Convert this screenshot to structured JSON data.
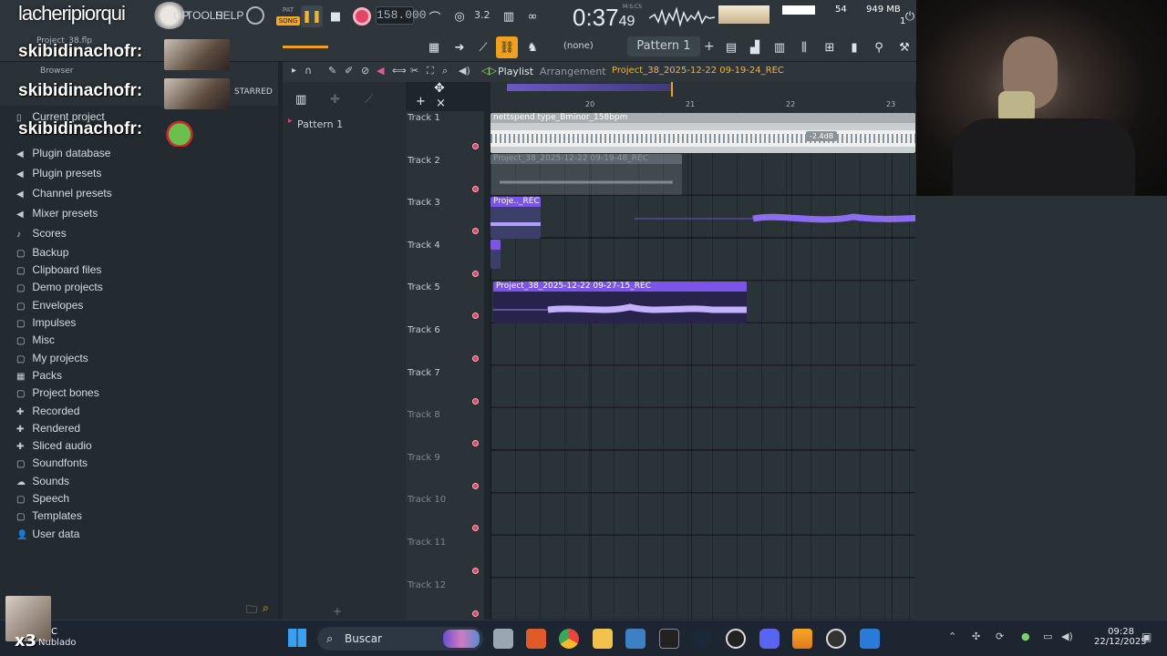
{
  "overlay": {
    "streamer_name": "lacheripiorqui",
    "chat_user": "skibidinachofr:",
    "badge": "x3"
  },
  "menu": {
    "tools": "TOOLS",
    "help": "HELP",
    "op": "OP"
  },
  "transport": {
    "pat_label": "PAT",
    "song_label": "SONG",
    "tempo": "158.000",
    "time_main": "0:37",
    "time_sub": "49",
    "time_unit": "M:S:CS",
    "cpu": "54",
    "memory": "949 MB",
    "memory_sub": "1",
    "snap": "(none)",
    "pattern": "Pattern 1",
    "step": "3.2"
  },
  "browser": {
    "project_file": "Project_38.flp",
    "title": "Browser",
    "starred": "STARRED",
    "items": [
      {
        "label": "Current project",
        "icon": "file-icon"
      },
      {
        "label": "Plugin database",
        "icon": "plug-icon"
      },
      {
        "label": "Plugin presets",
        "icon": "plug-icon"
      },
      {
        "label": "Channel presets",
        "icon": "plug-icon"
      },
      {
        "label": "Mixer presets",
        "icon": "plug-icon"
      },
      {
        "label": "Scores",
        "icon": "note-icon"
      },
      {
        "label": "Backup",
        "icon": "folder-icon"
      },
      {
        "label": "Clipboard files",
        "icon": "folder-icon"
      },
      {
        "label": "Demo projects",
        "icon": "folder-icon"
      },
      {
        "label": "Envelopes",
        "icon": "folder-icon"
      },
      {
        "label": "Impulses",
        "icon": "folder-icon"
      },
      {
        "label": "Misc",
        "icon": "folder-icon"
      },
      {
        "label": "My projects",
        "icon": "folder-icon"
      },
      {
        "label": "Packs",
        "icon": "packs-icon"
      },
      {
        "label": "Project bones",
        "icon": "folder-icon"
      },
      {
        "label": "Recorded",
        "icon": "plus-icon"
      },
      {
        "label": "Rendered",
        "icon": "plus-icon"
      },
      {
        "label": "Sliced audio",
        "icon": "plus-icon"
      },
      {
        "label": "Soundfonts",
        "icon": "folder-icon"
      },
      {
        "label": "Sounds",
        "icon": "cloud-icon"
      },
      {
        "label": "Speech",
        "icon": "folder-icon"
      },
      {
        "label": "Templates",
        "icon": "folder-icon"
      },
      {
        "label": "User data",
        "icon": "user-icon"
      }
    ]
  },
  "patterns": {
    "items": [
      "Pattern 1"
    ]
  },
  "playlist": {
    "title": "Playlist",
    "subtitle": "Arrangement",
    "project": "Project_38_2025-12-22 09-19-24_REC",
    "ruler": [
      "20",
      "21",
      "22",
      "23"
    ],
    "tracks": [
      "Track 1",
      "Track 2",
      "Track 3",
      "Track 4",
      "Track 5",
      "Track 6",
      "Track 7",
      "Track 8",
      "Track 9",
      "Track 10",
      "Track 11",
      "Track 12"
    ],
    "clips": [
      {
        "name": "nettspend type_Bminor_158bpm",
        "gain": "-2.4dB"
      },
      {
        "name": "Project_38_2025-12-22 09-19-48_REC"
      },
      {
        "name": "Proje.._REC"
      },
      {
        "name": ""
      },
      {
        "name": "Project_38_2025-12-22 09-27-15_REC"
      }
    ]
  },
  "taskbar": {
    "search": "Buscar",
    "time": "09:28",
    "date": "22/12/2025",
    "weather_temp": "C",
    "weather_desc": "Nublado"
  },
  "colors": {
    "accent": "#f2b33d",
    "clip_purple": "#7a55e8",
    "clip_gray": "#c9cdd0",
    "record": "#e0466a"
  }
}
